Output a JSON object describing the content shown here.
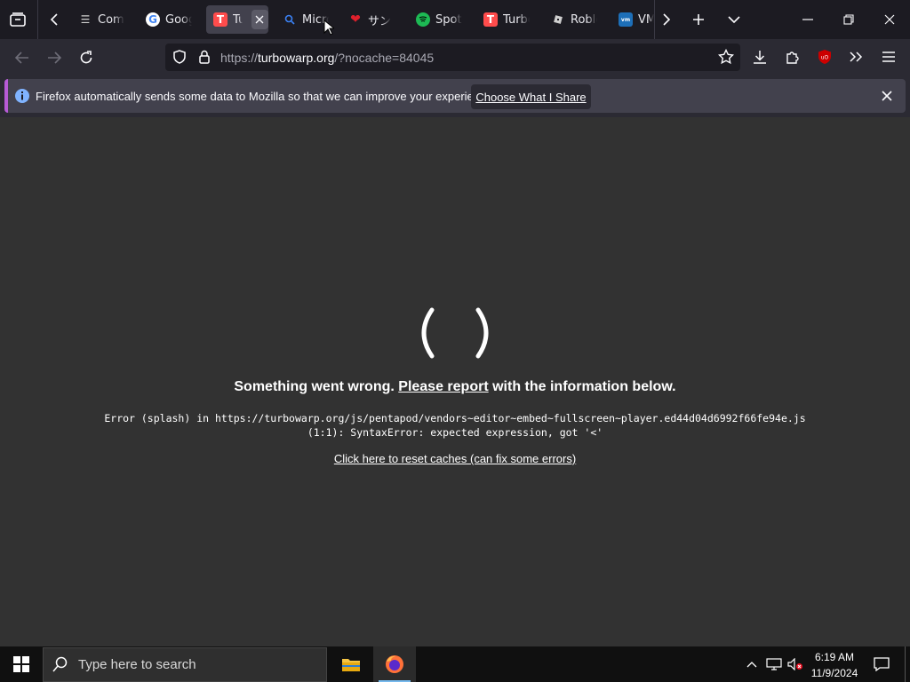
{
  "tabs": [
    {
      "label": "Comp",
      "favicon": "stack-icon",
      "color": "#cfcfcf"
    },
    {
      "label": "Goog",
      "favicon": "google-icon",
      "color": "#4285f4"
    },
    {
      "label": "Tu",
      "favicon": "turbowarp-icon",
      "color": "#ff4c4c",
      "active": true
    },
    {
      "label": "Micro",
      "favicon": "search-icon",
      "color": "#3b82f6"
    },
    {
      "label": "サン",
      "favicon": "red-blob-icon",
      "color": "#e0202c"
    },
    {
      "label": "Spoti",
      "favicon": "spotify-icon",
      "color": "#1db954"
    },
    {
      "label": "Turbo",
      "favicon": "turbowarp-icon",
      "color": "#ff4c4c"
    },
    {
      "label": "Roblo",
      "favicon": "roblox-icon",
      "color": "#cfcfcf"
    },
    {
      "label": "VM",
      "favicon": "vmware-icon",
      "color": "#1d6fb8"
    }
  ],
  "nav": {
    "url_host": "turbowarp.org",
    "url_prefix": "https://",
    "url_suffix": "/?nocache=84045"
  },
  "notification": {
    "text": "Firefox automatically sends some data to Mozilla so that we can improve your experience.",
    "button": "Choose What I Share"
  },
  "page": {
    "headline_pre": "Something went wrong. ",
    "headline_link": "Please report",
    "headline_post": " with the information below.",
    "error_line1": "Error (splash) in https://turbowarp.org/js/pentapod/vendors~editor~embed~fullscreen~player.ed44d04d6992f66fe94e.js",
    "error_line2": "(1:1): SyntaxError: expected expression, got '<'",
    "reset_link": "Click here to reset caches (can fix some errors)"
  },
  "taskbar": {
    "search_placeholder": "Type here to search",
    "time": "6:19 AM",
    "date": "11/9/2024"
  },
  "colors": {
    "accent": "#b75bd6",
    "tabstrip": "#1c1b22",
    "content_bg": "#323232"
  }
}
